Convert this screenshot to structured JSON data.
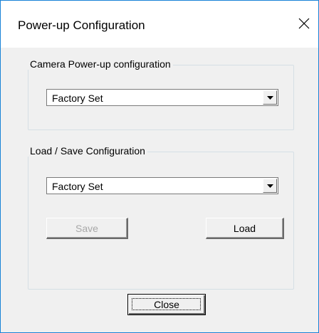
{
  "window": {
    "title": "Power-up Configuration",
    "close_icon": "close-icon"
  },
  "camera_group": {
    "label": "Camera Power-up configuration",
    "selected": "Factory Set",
    "dropdown_icon": "chevron-down-icon"
  },
  "load_save_group": {
    "label": "Load / Save Configuration",
    "selected": "Factory Set",
    "dropdown_icon": "chevron-down-icon",
    "save_label": "Save",
    "save_enabled": false,
    "load_label": "Load"
  },
  "footer": {
    "close_label": "Close"
  }
}
